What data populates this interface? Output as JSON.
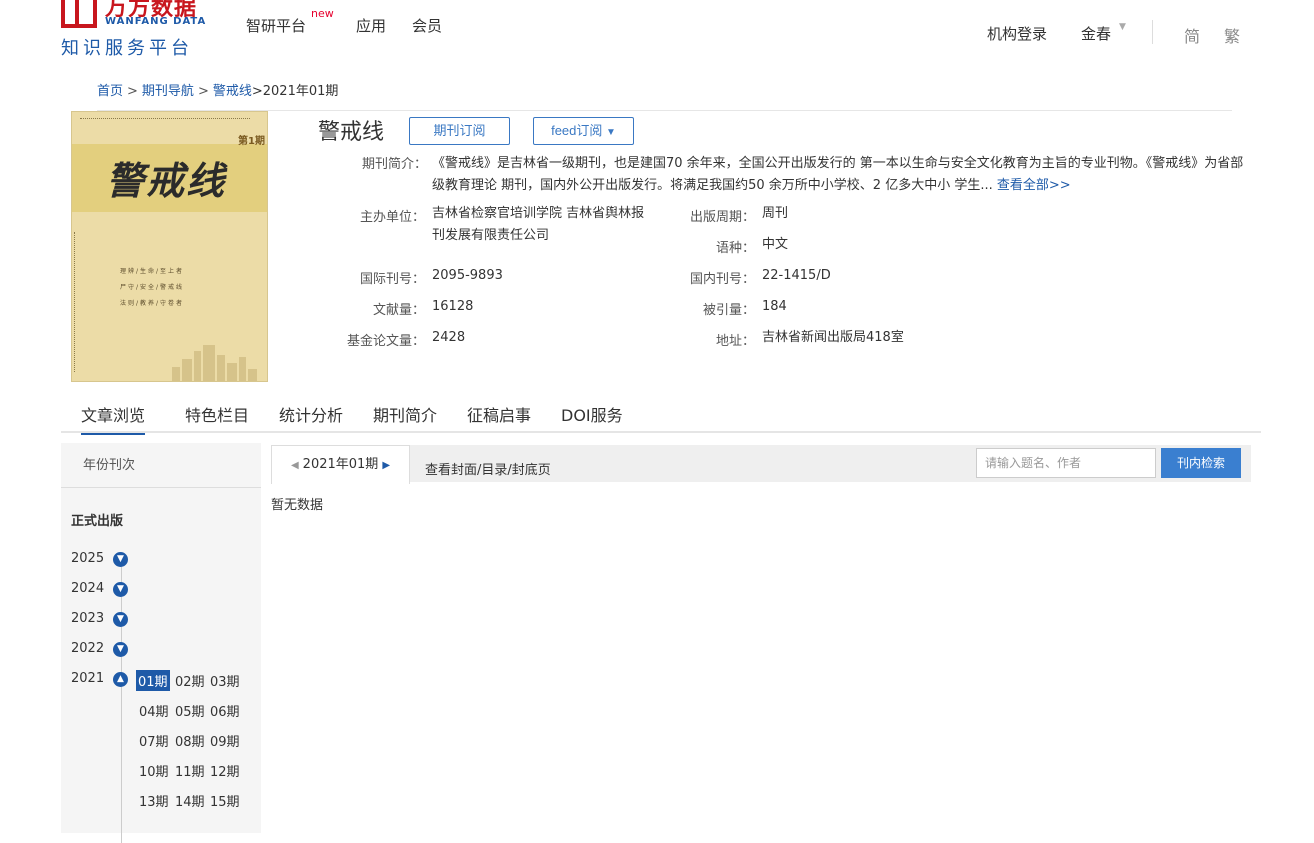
{
  "header": {
    "logo_cn": "万方数据",
    "logo_en": "WANFANG DATA",
    "logo_sub": "知识服务平台",
    "nav": [
      "智研平台",
      "应用",
      "会员"
    ],
    "nav_badge": "new",
    "org_login": "机构登录",
    "user": "金春",
    "lang_simple": "简",
    "lang_trad": "繁"
  },
  "breadcrumb": {
    "home": "首页",
    "journals": "期刊导航",
    "journal": "警戒线",
    "current": ">2021年01期"
  },
  "cover": {
    "title": "警戒线",
    "issue_mark": "第1期",
    "lines": [
      "理辨/生命/至上者",
      "尸守/安全/警戒线",
      "法则/教养/守卷者"
    ]
  },
  "journal": {
    "title": "警戒线",
    "subscribe_btn": "期刊订阅",
    "feed_btn": "feed订阅",
    "intro_label": "期刊简介：",
    "intro_text": "《警戒线》是吉林省一级期刊，也是建国70 余年来，全国公开出版发行的 第一本以生命与安全文化教育为主旨的专业刊物。《警戒线》为省部级教育理论 期刊，国内外公开出版发行。将满足我国约50 余万所中小学校、2 亿多大中小 学生...",
    "intro_more": "查看全部>>",
    "fields_left": [
      {
        "label": "主办单位：",
        "value": "吉林省检察官培训学院 吉林省舆林报刊发展有限责任公司"
      },
      {
        "label": "国际刊号：",
        "value": "2095-9893"
      },
      {
        "label": "文献量：",
        "value": "16128"
      },
      {
        "label": "基金论文量：",
        "value": "2428"
      }
    ],
    "fields_right": [
      {
        "label": "出版周期：",
        "value": "周刊"
      },
      {
        "label": "语种：",
        "value": "中文"
      },
      {
        "label": "国内刊号：",
        "value": "22-1415/D"
      },
      {
        "label": "被引量：",
        "value": "184"
      },
      {
        "label": "地址：",
        "value": "吉林省新闻出版局418室"
      }
    ]
  },
  "tabs": [
    "文章浏览",
    "特色栏目",
    "统计分析",
    "期刊简介",
    "征稿启事",
    "DOI服务"
  ],
  "left_panel": {
    "header": "年份刊次",
    "section": "正式出版",
    "years": [
      "2025",
      "2024",
      "2023",
      "2022",
      "2021"
    ],
    "issues": [
      "01期",
      "02期",
      "03期",
      "04期",
      "05期",
      "06期",
      "07期",
      "08期",
      "09期",
      "10期",
      "11期",
      "12期",
      "13期",
      "14期",
      "15期"
    ],
    "active_issue": "01期"
  },
  "right_panel": {
    "current_tab": "2021年01期",
    "cover_link": "查看封面/目录/封底页",
    "search_placeholder": "请输入题名、作者",
    "search_btn": "刊内检索",
    "empty": "暂无数据"
  }
}
